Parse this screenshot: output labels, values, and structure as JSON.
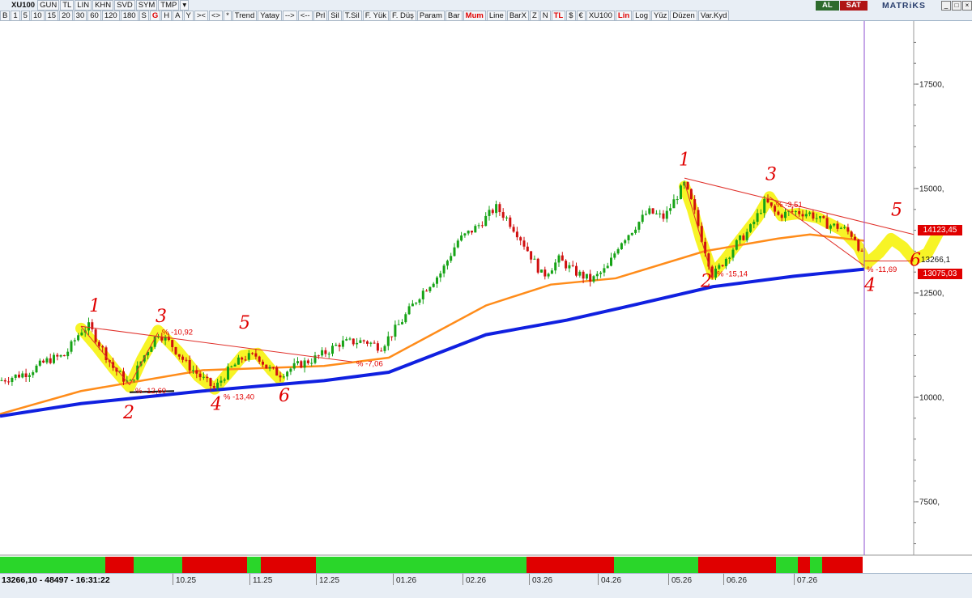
{
  "toolbar": {
    "row1": [
      "XU100",
      "GUN",
      "TL",
      "LIN",
      "KHN",
      "SVD",
      "SYM",
      "TMP",
      "▾"
    ],
    "row2": [
      "B",
      "1",
      "5",
      "10",
      "15",
      "20",
      "30",
      "60",
      "120",
      "180",
      "S",
      "G",
      "H",
      "A",
      "Y",
      "><",
      "<>",
      "*",
      "Trend",
      "Yatay",
      "-->",
      "<--",
      "Prl",
      "Sil",
      "T.Sil",
      "F. Yük",
      "F. Düş",
      "Param",
      "Bar",
      "Mum",
      "Line",
      "BarX",
      "Z",
      "N",
      "TL",
      "$",
      "€",
      "XU100",
      "Lin",
      "Log",
      "Yüz",
      "Düzen",
      "Var.Kyd"
    ],
    "highlight": [
      "G",
      "Mum",
      "TL",
      "Lin"
    ],
    "al_label": "AL",
    "sat_label": "SAT",
    "brand": "MATRiKS"
  },
  "status": {
    "text": "13266,10 - 48497 - 16:31:22",
    "dates": [
      "10.25",
      "11.25",
      "12.25",
      "01.26",
      "02.26",
      "03.26",
      "04.26",
      "05.26",
      "06.26",
      "07.26"
    ]
  },
  "price_tags": {
    "upper": "14123,45",
    "last": "13266,1",
    "lower": "13075,03"
  },
  "chart_data": {
    "type": "candlestick",
    "ticker": "XU100",
    "y_ticks": [
      7500,
      10000,
      12500,
      15000,
      17500
    ],
    "y_tick_labels": [
      "7500,",
      "10000,",
      "12500,",
      "15000,",
      "17500,"
    ],
    "ylim": [
      6300,
      18800
    ],
    "close_path": [
      [
        0,
        10400
      ],
      [
        35,
        10600
      ],
      [
        60,
        10900
      ],
      [
        80,
        11000
      ],
      [
        100,
        11600
      ],
      [
        110,
        11700
      ],
      [
        125,
        11200
      ],
      [
        140,
        10700
      ],
      [
        160,
        10300
      ],
      [
        175,
        10900
      ],
      [
        195,
        11550
      ],
      [
        210,
        11300
      ],
      [
        230,
        10800
      ],
      [
        250,
        10450
      ],
      [
        265,
        10200
      ],
      [
        280,
        10600
      ],
      [
        300,
        10950
      ],
      [
        318,
        11000
      ],
      [
        330,
        10700
      ],
      [
        345,
        10550
      ],
      [
        365,
        10750
      ],
      [
        385,
        10900
      ],
      [
        400,
        11050
      ],
      [
        420,
        11300
      ],
      [
        450,
        11350
      ],
      [
        470,
        11200
      ],
      [
        495,
        11800
      ],
      [
        520,
        12500
      ],
      [
        545,
        13000
      ],
      [
        565,
        13750
      ],
      [
        590,
        14100
      ],
      [
        612,
        14550
      ],
      [
        625,
        14300
      ],
      [
        640,
        13900
      ],
      [
        655,
        13400
      ],
      [
        670,
        12900
      ],
      [
        690,
        13300
      ],
      [
        710,
        13000
      ],
      [
        730,
        12800
      ],
      [
        750,
        13100
      ],
      [
        765,
        13700
      ],
      [
        780,
        14000
      ],
      [
        800,
        14450
      ],
      [
        820,
        14300
      ],
      [
        835,
        14800
      ],
      [
        845,
        15100
      ],
      [
        855,
        14600
      ],
      [
        865,
        13900
      ],
      [
        880,
        12900
      ],
      [
        895,
        13300
      ],
      [
        910,
        13700
      ],
      [
        925,
        14000
      ],
      [
        945,
        14700
      ],
      [
        960,
        14350
      ],
      [
        980,
        14450
      ],
      [
        1000,
        14400
      ],
      [
        1020,
        14150
      ],
      [
        1040,
        14050
      ],
      [
        1055,
        13850
      ],
      [
        1067,
        13266
      ]
    ],
    "series": [
      {
        "name": "",
        "color": "#ff8c1a",
        "points": [
          [
            0,
            9600
          ],
          [
            100,
            10150
          ],
          [
            250,
            10650
          ],
          [
            400,
            10750
          ],
          [
            480,
            10950
          ],
          [
            600,
            12200
          ],
          [
            680,
            12700
          ],
          [
            760,
            12850
          ],
          [
            870,
            13500
          ],
          [
            960,
            13800
          ],
          [
            1000,
            13900
          ],
          [
            1067,
            13750
          ]
        ]
      },
      {
        "name": "",
        "color": "#1020e0",
        "points": [
          [
            0,
            9550
          ],
          [
            100,
            9850
          ],
          [
            250,
            10150
          ],
          [
            400,
            10400
          ],
          [
            480,
            10600
          ],
          [
            600,
            11500
          ],
          [
            700,
            11850
          ],
          [
            780,
            12200
          ],
          [
            880,
            12650
          ],
          [
            980,
            12900
          ],
          [
            1067,
            13070
          ]
        ]
      }
    ],
    "annotations": [
      {
        "text": "% -12,60",
        "x": 167,
        "y": 10100
      },
      {
        "text": "% -10,92",
        "x": 200,
        "y": 11500
      },
      {
        "text": "% -13,40",
        "x": 276,
        "y": 9950
      },
      {
        "text": "% -7,06",
        "x": 440,
        "y": 10750
      },
      {
        "text": "% -15,14",
        "x": 885,
        "y": 12900
      },
      {
        "text": "% -3,51",
        "x": 958,
        "y": 14550
      },
      {
        "text": "% -11,69",
        "x": 1070,
        "y": 13000
      }
    ],
    "wave_labels": [
      {
        "text": "1",
        "x": 110,
        "y": 12050
      },
      {
        "text": "2",
        "x": 152,
        "y": 9500
      },
      {
        "text": "3",
        "x": 192,
        "y": 11800
      },
      {
        "text": "4",
        "x": 260,
        "y": 9700
      },
      {
        "text": "5",
        "x": 295,
        "y": 11650
      },
      {
        "text": "6",
        "x": 344,
        "y": 9900
      },
      {
        "text": "1",
        "x": 838,
        "y": 15550
      },
      {
        "text": "2",
        "x": 865,
        "y": 12650
      },
      {
        "text": "3",
        "x": 945,
        "y": 15200
      },
      {
        "text": "4",
        "x": 1067,
        "y": 12550
      },
      {
        "text": "5",
        "x": 1100,
        "y": 14350
      },
      {
        "text": "6",
        "x": 1123,
        "y": 13150
      }
    ],
    "indicator_bands": [
      {
        "color": "#2ad62a",
        "from": 0,
        "to": 130
      },
      {
        "color": "#e00000",
        "from": 130,
        "to": 165
      },
      {
        "color": "#2ad62a",
        "from": 165,
        "to": 225
      },
      {
        "color": "#e00000",
        "from": 225,
        "to": 305
      },
      {
        "color": "#2ad62a",
        "from": 305,
        "to": 322
      },
      {
        "color": "#e00000",
        "from": 322,
        "to": 390
      },
      {
        "color": "#2ad62a",
        "from": 390,
        "to": 650
      },
      {
        "color": "#e00000",
        "from": 650,
        "to": 758
      },
      {
        "color": "#2ad62a",
        "from": 758,
        "to": 862
      },
      {
        "color": "#e00000",
        "from": 862,
        "to": 958
      },
      {
        "color": "#2ad62a",
        "from": 958,
        "to": 985
      },
      {
        "color": "#e00000",
        "from": 985,
        "to": 1000
      },
      {
        "color": "#2ad62a",
        "from": 1000,
        "to": 1015
      },
      {
        "color": "#e00000",
        "from": 1015,
        "to": 1065
      }
    ],
    "grid": false,
    "colors": {
      "up": "#16a316",
      "down": "#d01010",
      "trendline": "#e0302a",
      "highlight": "#f6f200",
      "cursor": "#8c4fd0",
      "wave_label": "#e00000"
    }
  }
}
